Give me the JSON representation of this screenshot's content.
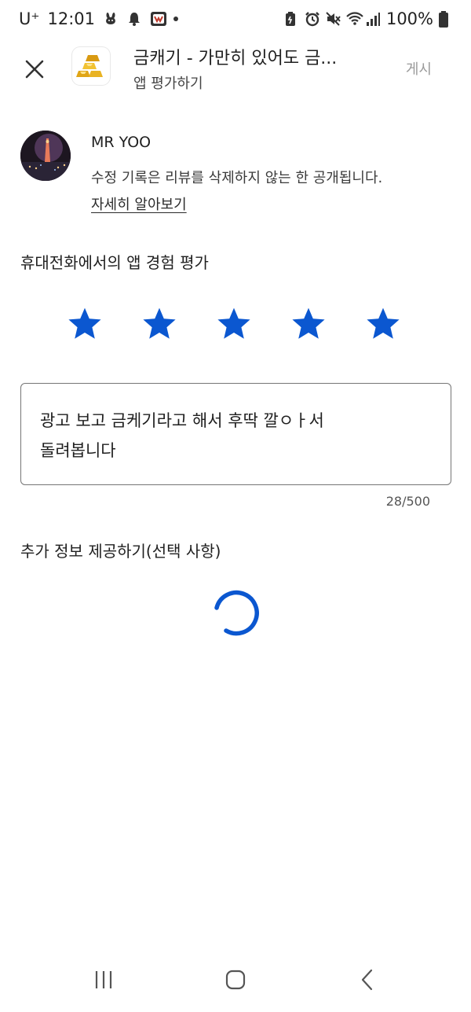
{
  "status_bar": {
    "carrier": "U⁺",
    "time": "12:01",
    "battery": "100%",
    "left_icons": [
      "bunny-icon",
      "bell-icon",
      "app-notification-icon"
    ],
    "right_icons": [
      "battery-saver-icon",
      "alarm-icon",
      "mute-icon",
      "wifi-icon",
      "signal-icon",
      "battery-icon"
    ]
  },
  "app_bar": {
    "title": "금캐기 - 가만히 있어도 금...",
    "subtitle": "앱 평가하기",
    "post_label": "게시",
    "app_icon": "gold-bars-icon"
  },
  "user": {
    "name": "MR YOO",
    "notice": "수정 기록은 리뷰를 삭제하지 않는 한 공개됩니다.",
    "learn_more": "자세히 알아보기"
  },
  "rating": {
    "title": "휴대전화에서의 앱 경험 평가",
    "stars": 5,
    "max_stars": 5,
    "color": "#0b57d0"
  },
  "review": {
    "text": "광고 보고 금케기라고 해서 후딱 깔ㅇㅏ서\n돌려봅니다",
    "counter": "28/500"
  },
  "extra": {
    "title": "추가 정보 제공하기(선택 사항)"
  },
  "nav": {
    "recent_icon": "recent-apps-icon",
    "home_icon": "home-icon",
    "back_icon": "back-icon"
  }
}
